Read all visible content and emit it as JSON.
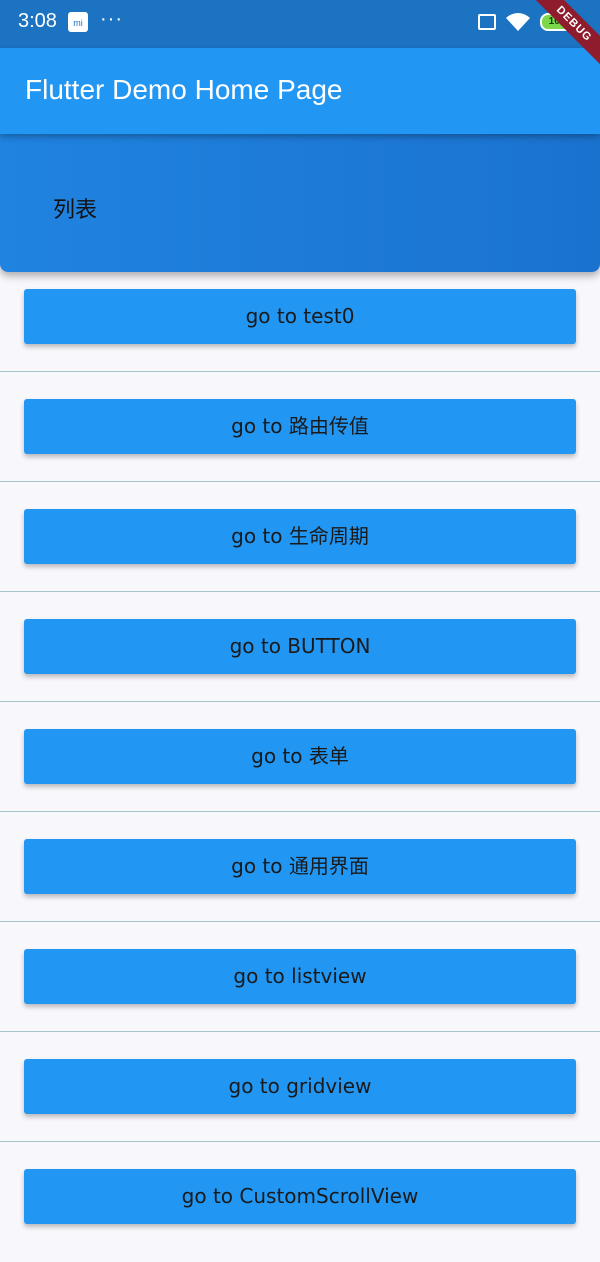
{
  "status_bar": {
    "time": "3:08",
    "more": "···",
    "app_icon": "mi",
    "battery": "100"
  },
  "debug_banner": "DEBUG",
  "app_bar": {
    "title": "Flutter Demo Home Page"
  },
  "header": {
    "title": "列表"
  },
  "buttons": [
    "go to test0",
    "go to 路由传值",
    "go to 生命周期",
    "go to BUTTON",
    "go to 表单",
    "go to 通用界面",
    "go to listview",
    "go to gridview",
    "go to CustomScrollView"
  ],
  "colors": {
    "status_bar": "#1c73c2",
    "app_bar": "#2196f3",
    "button": "#2196f3",
    "background": "#f8f7fb",
    "divider": "#a7c6cc"
  }
}
